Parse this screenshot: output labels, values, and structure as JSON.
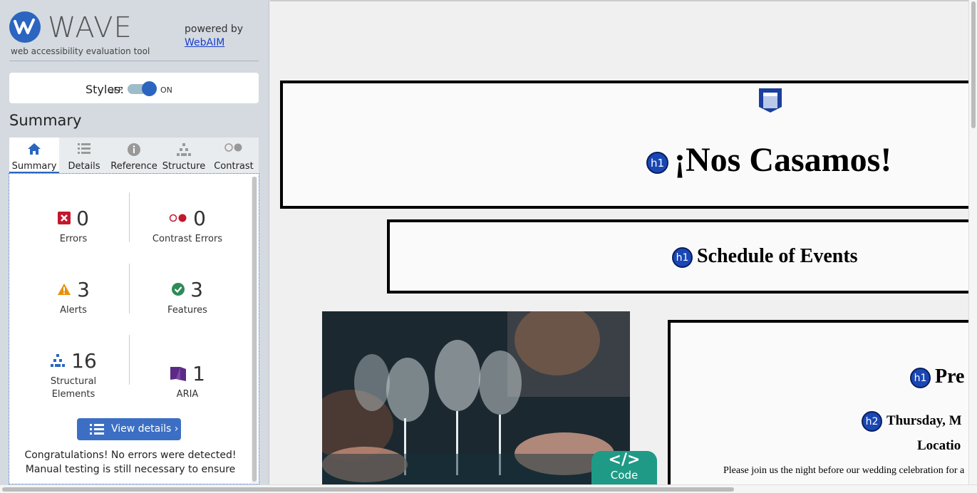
{
  "brand": {
    "name": "WAVE",
    "tagline": "web accessibility evaluation tool",
    "powered_by": "powered by",
    "powered_link": "WebAIM"
  },
  "styles": {
    "label": "Styles:",
    "off": "OFF",
    "on": "ON",
    "state": "on"
  },
  "summary_heading": "Summary",
  "tabs": [
    {
      "label": "Summary",
      "icon": "home-icon"
    },
    {
      "label": "Details",
      "icon": "list-icon"
    },
    {
      "label": "Reference",
      "icon": "info-icon"
    },
    {
      "label": "Structure",
      "icon": "structure-icon"
    },
    {
      "label": "Contrast",
      "icon": "contrast-icon"
    }
  ],
  "stats": {
    "errors": {
      "count": "0",
      "label": "Errors"
    },
    "contrast": {
      "count": "0",
      "label": "Contrast Errors"
    },
    "alerts": {
      "count": "3",
      "label": "Alerts"
    },
    "features": {
      "count": "3",
      "label": "Features"
    },
    "structural": {
      "count": "16",
      "label": "Structural Elements"
    },
    "aria": {
      "count": "1",
      "label": "ARIA"
    }
  },
  "view_details": "View details ›",
  "congrats": "Congratulations! No errors were detected! Manual testing is still necessary to ensure",
  "page": {
    "h1_title": "¡Nos Casamos!",
    "h1_schedule": "Schedule of Events",
    "h1_pre": "Pre",
    "h2_date": "Thursday, M",
    "location": "Locatio",
    "invite": "Please join us the night before our wedding celebration for a",
    "badge_h1": "h1",
    "badge_h2": "h2",
    "code_tab": "Code",
    "code_symbol": "</>"
  },
  "colors": {
    "accent": "#2b65c0",
    "error": "#c4172c",
    "alert": "#e8900c",
    "feature": "#2e8b57",
    "aria": "#5b2a86",
    "code": "#1f9a86"
  }
}
